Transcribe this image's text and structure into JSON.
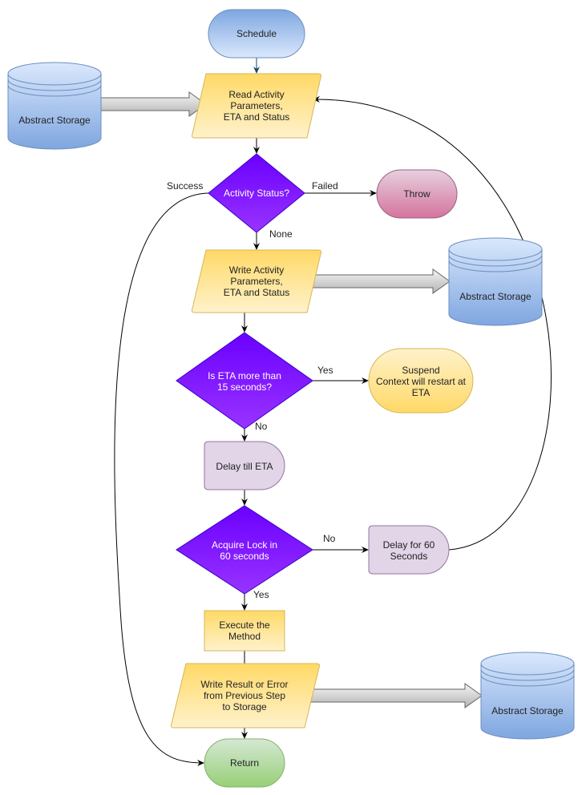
{
  "nodes": {
    "schedule": [
      "Schedule"
    ],
    "read": [
      "Read Activity",
      "Parameters,",
      "ETA and Status"
    ],
    "storage1": [
      "Abstract Storage"
    ],
    "status_decision": [
      "Activity Status?"
    ],
    "throw": [
      "Throw"
    ],
    "write": [
      "Write Activity",
      "Parameters,",
      "ETA and Status"
    ],
    "storage2": [
      "Abstract Storage"
    ],
    "eta_decision": [
      "Is ETA more than",
      "15 seconds?"
    ],
    "suspend": [
      "Suspend",
      "Context will restart at",
      "ETA"
    ],
    "delay_eta": [
      "Delay till ETA"
    ],
    "lock_decision": [
      "Acquire Lock in",
      "60 seconds"
    ],
    "delay60": [
      "Delay for 60",
      "Seconds"
    ],
    "execute": [
      "Execute the",
      "Method"
    ],
    "write_result": [
      "Write Result or Error",
      "from Previous Step",
      "to Storage"
    ],
    "storage3": [
      "Abstract Storage"
    ],
    "return": [
      "Return"
    ]
  },
  "edge_labels": {
    "success": "Success",
    "failed": "Failed",
    "none": "None",
    "eta_yes": "Yes",
    "eta_no": "No",
    "lock_no": "No",
    "lock_yes": "Yes"
  },
  "colors": {
    "process_top": "#ffd966",
    "process_bottom": "#fff2cc",
    "process_stroke": "#d6b656",
    "storage_top": "#dae8fc",
    "storage_bottom": "#7ea6e0",
    "storage_stroke": "#6c8ebf",
    "decision_top": "#6a00ff",
    "decision_bottom": "#9933ff",
    "decision_stroke": "#3700cc",
    "throw_top": "#e6d0de",
    "throw_bottom": "#d5739d",
    "throw_stroke": "#996185",
    "delay_fill": "#e1d5e7",
    "delay_stroke": "#9673a6",
    "return_top": "#d5e8d4",
    "return_bottom": "#97d077",
    "return_stroke": "#82b366"
  }
}
